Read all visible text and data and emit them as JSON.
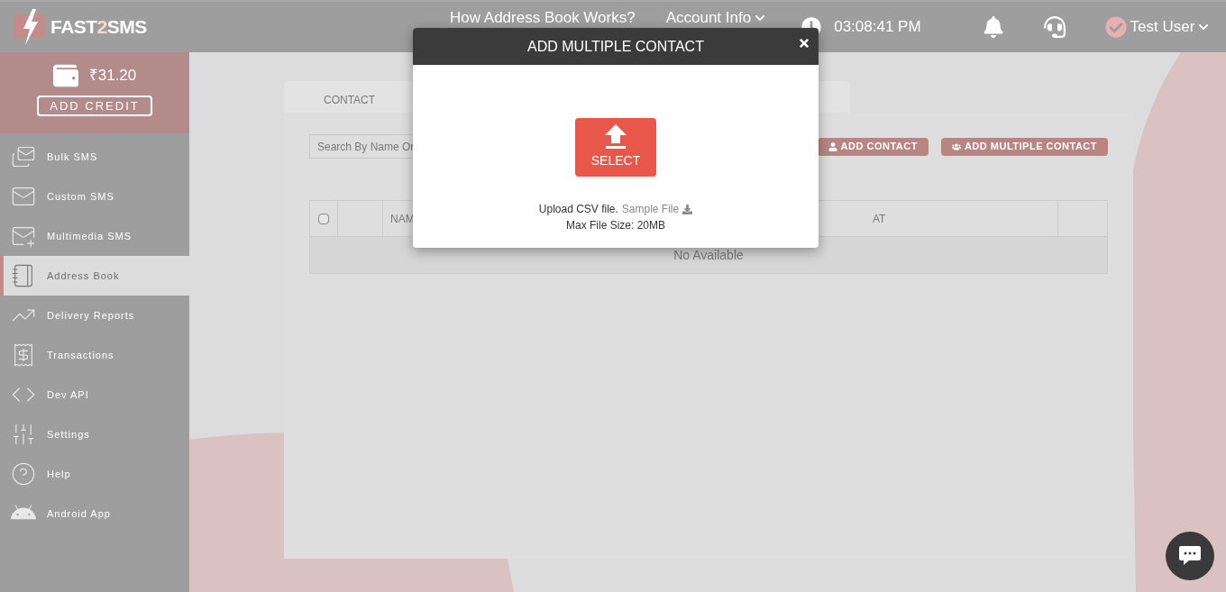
{
  "header": {
    "logo": {
      "prefix": "FAST",
      "highlight": "2",
      "suffix": "SMS"
    },
    "links": [
      {
        "label": "How Address Book Works?",
        "kind": "plain"
      },
      {
        "label": "Account Info",
        "kind": "dropdown"
      }
    ],
    "time": "03:08:41 PM",
    "user": {
      "name": "Test User"
    }
  },
  "wallet": {
    "balance": "₹31.20",
    "button": "ADD CREDIT"
  },
  "sidebar": {
    "items": [
      {
        "label": "Bulk SMS",
        "selected": false,
        "kind": "bulk"
      },
      {
        "label": "Custom SMS",
        "selected": false,
        "kind": "custom"
      },
      {
        "label": "Multimedia SMS",
        "selected": false,
        "kind": "multimedia"
      },
      {
        "label": "Address Book",
        "selected": true,
        "kind": "book"
      },
      {
        "label": "Delivery Reports",
        "selected": false,
        "kind": "reports"
      },
      {
        "label": "Transactions",
        "selected": false,
        "kind": "transactions"
      },
      {
        "label": "Dev API",
        "selected": false,
        "kind": "api"
      },
      {
        "label": "Settings",
        "selected": false,
        "kind": "settings"
      },
      {
        "label": "Help",
        "selected": false,
        "kind": "help"
      },
      {
        "label": "Android App",
        "selected": false,
        "kind": "android"
      }
    ]
  },
  "content": {
    "tabs": [
      {
        "label": "CONTACT",
        "selected": false
      }
    ],
    "search": {
      "placeholder": "Search By Name Or"
    },
    "buttons": [
      {
        "label": "ADD CONTACT",
        "kind": "single"
      },
      {
        "label": "ADD MULTIPLE CONTACT",
        "kind": "group"
      }
    ],
    "table": {
      "select_all_checked": false,
      "columns": [
        "NAM",
        "AT"
      ],
      "empty": "No Available"
    }
  },
  "modal": {
    "title": "ADD MULTIPLE CONTACT",
    "select_button": "SELECT",
    "upload_text": "Upload CSV file.",
    "sample_link": "Sample File",
    "limit": "Max File Size: 20MB"
  }
}
